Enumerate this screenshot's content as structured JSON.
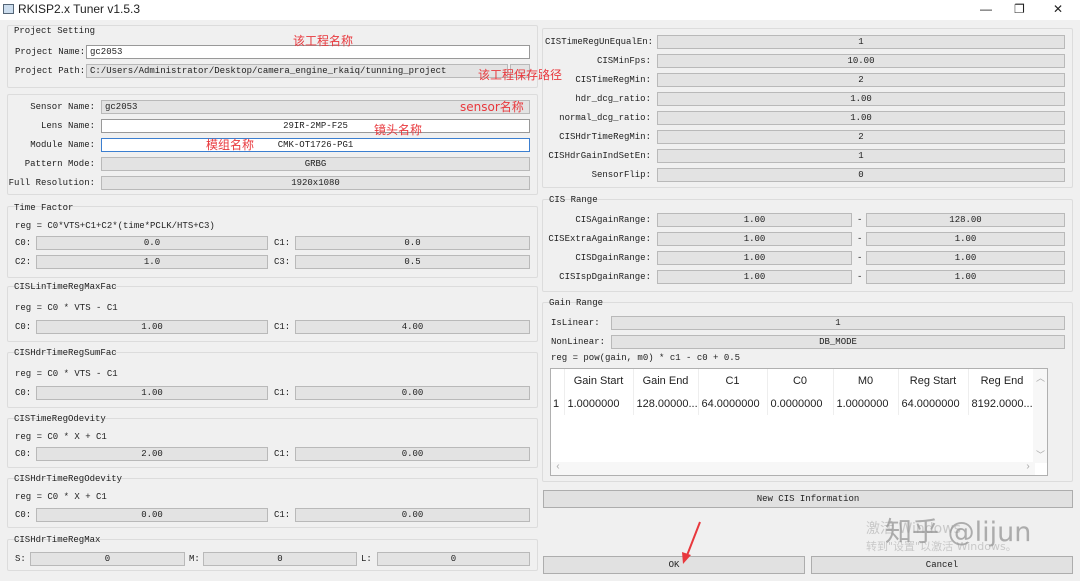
{
  "window": {
    "title": "RKISP2.x Tuner v1.5.3",
    "minimize": "—",
    "maximize": "❐",
    "close": "✕"
  },
  "project": {
    "group": "Project Setting",
    "name_label": "Project Name:",
    "name_value": "gc2053",
    "path_label": "Project Path:",
    "path_value": "C:/Users/Administrator/Desktop/camera_engine_rkaiq/tunning_project"
  },
  "sensor": {
    "sensor_label": "Sensor Name:",
    "sensor_value": "gc2053",
    "lens_label": "Lens Name:",
    "lens_value": "29IR-2MP-F25",
    "module_label": "Module Name:",
    "module_value": "CMK-OT1726-PG1",
    "pattern_label": "Pattern Mode:",
    "pattern_value": "GRBG",
    "res_label": "Full Resolution:",
    "res_value": "1920x1080"
  },
  "annotations": {
    "project_name": "该工程名称",
    "project_path": "该工程保存路径",
    "sensor": "sensor名称",
    "lens": "镜头名称",
    "module": "模组名称"
  },
  "time_factor": {
    "title": "Time Factor",
    "formula": "reg = C0*VTS+C1+C2*(time*PCLK/HTS+C3)",
    "c0_label": "C0:",
    "c0": "0.0",
    "c1_label": "C1:",
    "c1": "0.0",
    "c2_label": "C2:",
    "c2": "1.0",
    "c3_label": "C3:",
    "c3": "0.5"
  },
  "groups": [
    {
      "title": "CISLinTimeRegMaxFac",
      "formula": "reg = C0 * VTS - C1",
      "c0_label": "C0:",
      "c0": "1.00",
      "c1_label": "C1:",
      "c1": "4.00"
    },
    {
      "title": "CISHdrTimeRegSumFac",
      "formula": "reg = C0 * VTS - C1",
      "c0_label": "C0:",
      "c0": "1.00",
      "c1_label": "C1:",
      "c1": "0.00"
    },
    {
      "title": "CISTimeRegOdevity",
      "formula": "reg = C0 * X + C1",
      "c0_label": "C0:",
      "c0": "2.00",
      "c1_label": "C1:",
      "c1": "0.00"
    },
    {
      "title": "CISHdrTimeRegOdevity",
      "formula": "reg = C0 * X + C1",
      "c0_label": "C0:",
      "c0": "0.00",
      "c1_label": "C1:",
      "c1": "0.00"
    }
  ],
  "hdr_max": {
    "title": "CISHdrTimeRegMax",
    "s_label": "S:",
    "s": "0",
    "m_label": "M:",
    "m": "0",
    "l_label": "L:",
    "l": "0"
  },
  "cis_params": [
    {
      "label": "CISTimeRegUnEqualEn:",
      "value": "1"
    },
    {
      "label": "CISMinFps:",
      "value": "10.00"
    },
    {
      "label": "CISTimeRegMin:",
      "value": "2"
    },
    {
      "label": "hdr_dcg_ratio:",
      "value": "1.00"
    },
    {
      "label": "normal_dcg_ratio:",
      "value": "1.00"
    },
    {
      "label": "CISHdrTimeRegMin:",
      "value": "2"
    },
    {
      "label": "CISHdrGainIndSetEn:",
      "value": "1"
    },
    {
      "label": "SensorFlip:",
      "value": "0"
    }
  ],
  "cis_range": {
    "title": "CIS Range",
    "sep": "-",
    "rows": [
      {
        "label": "CISAgainRange:",
        "min": "1.00",
        "max": "128.00"
      },
      {
        "label": "CISExtraAgainRange:",
        "min": "1.00",
        "max": "1.00"
      },
      {
        "label": "CISDgainRange:",
        "min": "1.00",
        "max": "1.00"
      },
      {
        "label": "CISIspDgainRange:",
        "min": "1.00",
        "max": "1.00"
      }
    ]
  },
  "gain_range": {
    "title": "Gain Range",
    "islinear_label": "IsLinear:",
    "islinear": "1",
    "nonlinear_label": "NonLinear:",
    "nonlinear": "DB_MODE",
    "formula": "reg = pow(gain, m0) * c1 - c0 + 0.5",
    "columns": [
      "Gain Start",
      "Gain End",
      "C1",
      "C0",
      "M0",
      "Reg Start",
      "Reg End"
    ],
    "rows": [
      {
        "index": "1",
        "cells": [
          "1.0000000",
          "128.00000...",
          "64.0000000",
          "0.0000000",
          "1.0000000",
          "64.0000000",
          "8192.0000..."
        ]
      }
    ]
  },
  "buttons": {
    "new_cis": "New CIS Information",
    "ok": "OK",
    "cancel": "Cancel"
  },
  "watermark": {
    "brand": "知乎 @lijun",
    "activate1": "激活 Windows",
    "activate2": "转到\"设置\"以激活 Windows。"
  }
}
